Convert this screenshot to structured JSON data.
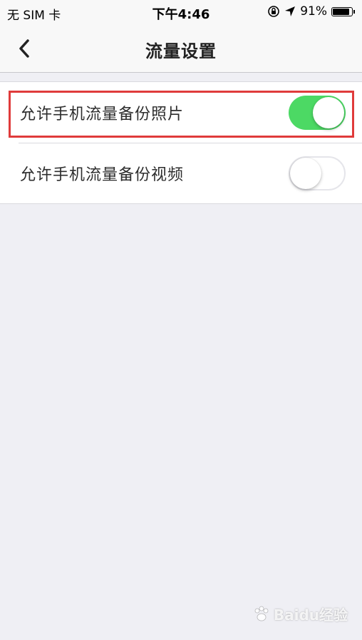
{
  "status_bar": {
    "carrier": "无 SIM 卡",
    "time": "下午4:46",
    "battery_percent": "91%",
    "battery_level": 0.91
  },
  "nav": {
    "title": "流量设置",
    "back_icon": "chevron-left-icon"
  },
  "settings": {
    "items": [
      {
        "label": "允许手机流量备份照片",
        "enabled": true
      },
      {
        "label": "允许手机流量备份视频",
        "enabled": false
      }
    ]
  },
  "colors": {
    "toggle_on": "#4cd964",
    "highlight": "#e03b3b",
    "background": "#efeff4"
  },
  "watermark": {
    "text": "Baidu经验"
  }
}
